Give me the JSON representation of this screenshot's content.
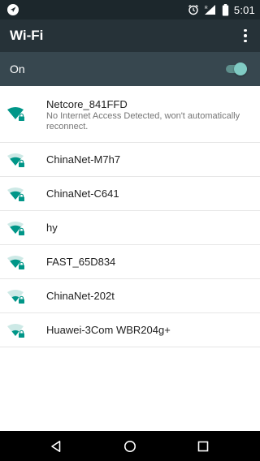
{
  "status_bar": {
    "time": "5:01",
    "icons": [
      "navigation-icon",
      "alarm-icon",
      "cell-signal-icon",
      "battery-icon"
    ]
  },
  "app_bar": {
    "title": "Wi-Fi",
    "menu_icon": "more-vert-icon"
  },
  "wifi_switch": {
    "label": "On",
    "state": "on",
    "accent_color": "#80cbc4"
  },
  "networks": [
    {
      "name": "Netcore_841FFD",
      "status": "No Internet Access Detected, won't automatically reconnect.",
      "icon": "wifi-secure-icon"
    },
    {
      "name": "ChinaNet-M7h7",
      "icon": "wifi-secure-icon"
    },
    {
      "name": "ChinaNet-C641",
      "icon": "wifi-secure-icon"
    },
    {
      "name": "hy",
      "icon": "wifi-secure-icon"
    },
    {
      "name": "FAST_65D834",
      "icon": "wifi-secure-icon"
    },
    {
      "name": "ChinaNet-202t",
      "icon": "wifi-secure-icon"
    },
    {
      "name": "Huawei-3Com WBR204g+",
      "icon": "wifi-secure-icon"
    }
  ],
  "nav_bar": {
    "buttons": [
      "back-icon",
      "home-icon",
      "recents-icon"
    ]
  },
  "colors": {
    "status_bar": "#1c272c",
    "app_bar": "#263238",
    "switch_bar": "#37474f",
    "wifi_icon": "#009688"
  }
}
